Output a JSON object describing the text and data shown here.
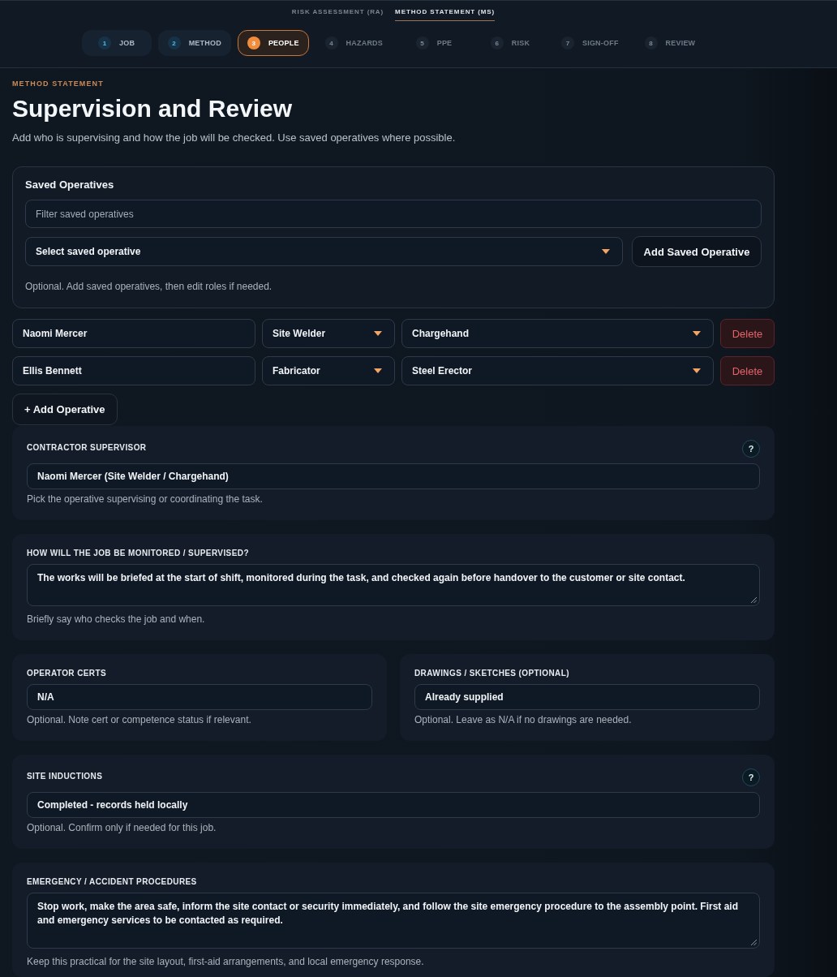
{
  "mode_tabs": [
    {
      "label": "RISK ASSESSMENT (RA)",
      "selected": false
    },
    {
      "label": "METHOD STATEMENT (MS)",
      "selected": true
    }
  ],
  "steps": [
    {
      "number": "1",
      "label": "JOB",
      "completed": true,
      "selected": false
    },
    {
      "number": "2",
      "label": "METHOD",
      "completed": true,
      "selected": false
    },
    {
      "number": "3",
      "label": "PEOPLE",
      "completed": false,
      "selected": true
    },
    {
      "number": "4",
      "label": "HAZARDS",
      "completed": false,
      "selected": false
    },
    {
      "number": "5",
      "label": "PPE",
      "completed": false,
      "selected": false
    },
    {
      "number": "6",
      "label": "RISK",
      "completed": false,
      "selected": false
    },
    {
      "number": "7",
      "label": "SIGN-OFF",
      "completed": false,
      "selected": false
    },
    {
      "number": "8",
      "label": "REVIEW",
      "completed": false,
      "selected": false
    }
  ],
  "page": {
    "eyebrow": "METHOD STATEMENT",
    "title": "Supervision and Review",
    "subtitle": "Add who is supervising and how the job will be checked. Use saved operatives where possible."
  },
  "saved_operatives": {
    "title": "Saved Operatives",
    "filter": {
      "kind": "input",
      "placeholder": "Filter saved operatives"
    },
    "select": {
      "kind": "select",
      "value": "Select saved operative"
    },
    "add_button": "Add Saved Operative",
    "hint": "Optional. Add saved operatives, then edit roles if needed."
  },
  "operatives": [
    {
      "name": "Naomi Mercer",
      "trade": "Site Welder",
      "role": "Chargehand",
      "delete_label": "Delete"
    },
    {
      "name": "Ellis Bennett",
      "trade": "Fabricator",
      "role": "Steel Erector",
      "delete_label": "Delete"
    }
  ],
  "add_operative_button": "+ Add Operative",
  "sections": [
    {
      "cards": [
        {
          "label": "CONTRACTOR SUPERVISOR",
          "help": "?",
          "field": {
            "kind": "input",
            "value": "Naomi Mercer (Site Welder / Chargehand)"
          },
          "hint": "Pick the operative supervising or coordinating the task."
        }
      ]
    },
    {
      "cards": [
        {
          "label": "HOW WILL THE JOB BE MONITORED / SUPERVISED?",
          "field": {
            "kind": "textarea",
            "value": "The works will be briefed at the start of shift, monitored during the task, and checked again before handover to the customer or site contact."
          },
          "hint": "Briefly say who checks the job and when."
        }
      ]
    },
    {
      "cards": [
        {
          "label": "OPERATOR CERTS",
          "field": {
            "kind": "input",
            "value": "N/A"
          },
          "hint": "Optional. Note cert or competence status if relevant."
        },
        {
          "label": "DRAWINGS / SKETCHES (OPTIONAL)",
          "field": {
            "kind": "input",
            "value": "Already supplied"
          },
          "hint": "Optional. Leave as N/A if no drawings are needed."
        }
      ]
    },
    {
      "cards": [
        {
          "label": "SITE INDUCTIONS",
          "help": "?",
          "field": {
            "kind": "input",
            "value": "Completed - records held locally"
          },
          "hint": "Optional. Confirm only if needed for this job."
        }
      ]
    },
    {
      "cards": [
        {
          "label": "EMERGENCY / ACCIDENT PROCEDURES",
          "field": {
            "kind": "textarea",
            "value": "Stop work, make the area safe, inform the site contact or security immediately, and follow the site emergency procedure to the assembly point. First aid and emergency services to be contacted as required."
          },
          "hint": "Keep this practical for the site layout, first-aid arrangements, and local emergency response."
        }
      ]
    }
  ]
}
